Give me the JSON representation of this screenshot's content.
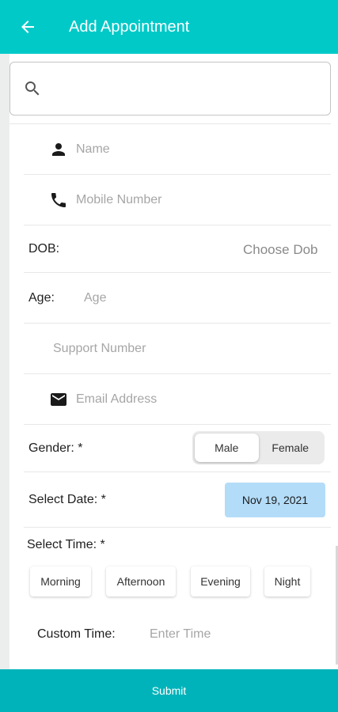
{
  "appbar": {
    "title": "Add Appointment",
    "accent": "#00c9c8"
  },
  "search": {
    "placeholder": ""
  },
  "fields": {
    "name_placeholder": "Name",
    "mobile_placeholder": "Mobile Number",
    "dob_label": "DOB:",
    "dob_action": "Choose Dob",
    "age_label": "Age:",
    "age_placeholder": "Age",
    "support_placeholder": "Support Number",
    "email_placeholder": "Email Address"
  },
  "gender": {
    "label": "Gender: *",
    "options": [
      "Male",
      "Female"
    ],
    "selected": "Male"
  },
  "date": {
    "label": "Select Date: *",
    "value": "Nov 19, 2021",
    "chip_color": "#b3dcf8"
  },
  "time": {
    "label": "Select Time: *",
    "options": [
      "Morning",
      "Afternoon",
      "Evening",
      "Night"
    ],
    "custom_label": "Custom Time:",
    "custom_placeholder": "Enter Time"
  },
  "submit": {
    "label": "Submit",
    "color": "#00b3ba"
  },
  "icons": [
    "back-arrow-icon",
    "search-icon",
    "person-icon",
    "phone-icon",
    "email-icon"
  ]
}
